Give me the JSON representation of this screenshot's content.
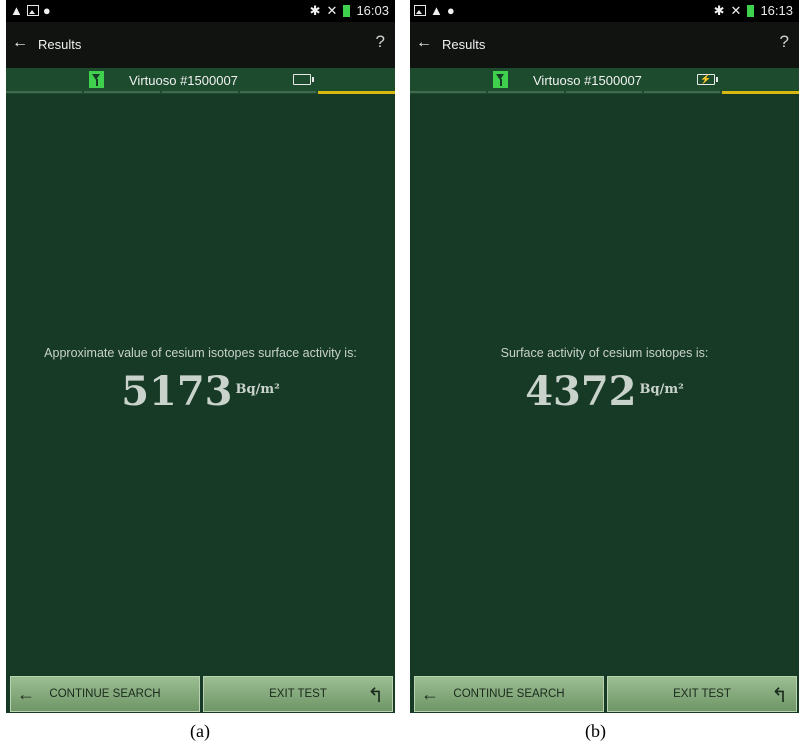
{
  "panels": [
    {
      "status_time": "16:03",
      "header_title": "Results",
      "help_label": "?",
      "device_name": "Virtuoso #1500007",
      "battery_state": "empty",
      "battery_glyph": "",
      "message": "Approximate value of cesium isotopes surface activity is:",
      "value": "5173",
      "unit": "Bq/m²",
      "continue_label": "CONTINUE SEARCH",
      "exit_label": "EXIT TEST",
      "caption": "(a)"
    },
    {
      "status_time": "16:13",
      "header_title": "Results",
      "help_label": "?",
      "device_name": "Virtuoso #1500007",
      "battery_state": "charging",
      "battery_glyph": "⚡",
      "message": "Surface activity of cesium isotopes is:",
      "value": "4372",
      "unit": "Bq/m²",
      "continue_label": "CONTINUE SEARCH",
      "exit_label": "EXIT TEST",
      "caption": "(b)"
    }
  ],
  "icons": {
    "back": "arrow-left-icon",
    "continue": "arrow-left-icon",
    "exit": "return-icon",
    "antenna": "antenna-icon",
    "battery": "battery-icon",
    "status_left": [
      "warning-icon",
      "image-icon",
      "apple-icon"
    ],
    "status_right": [
      "bluetooth-icon",
      "mute-icon",
      "battery-icon"
    ]
  },
  "colors": {
    "screen_bg": "#173a26",
    "actionbar_bg": "#111311",
    "device_bar_bg": "#1d4b2e",
    "active_tab": "#d9b712",
    "antenna": "#3fd14e",
    "button_gradient_top": "#9bbd92"
  }
}
